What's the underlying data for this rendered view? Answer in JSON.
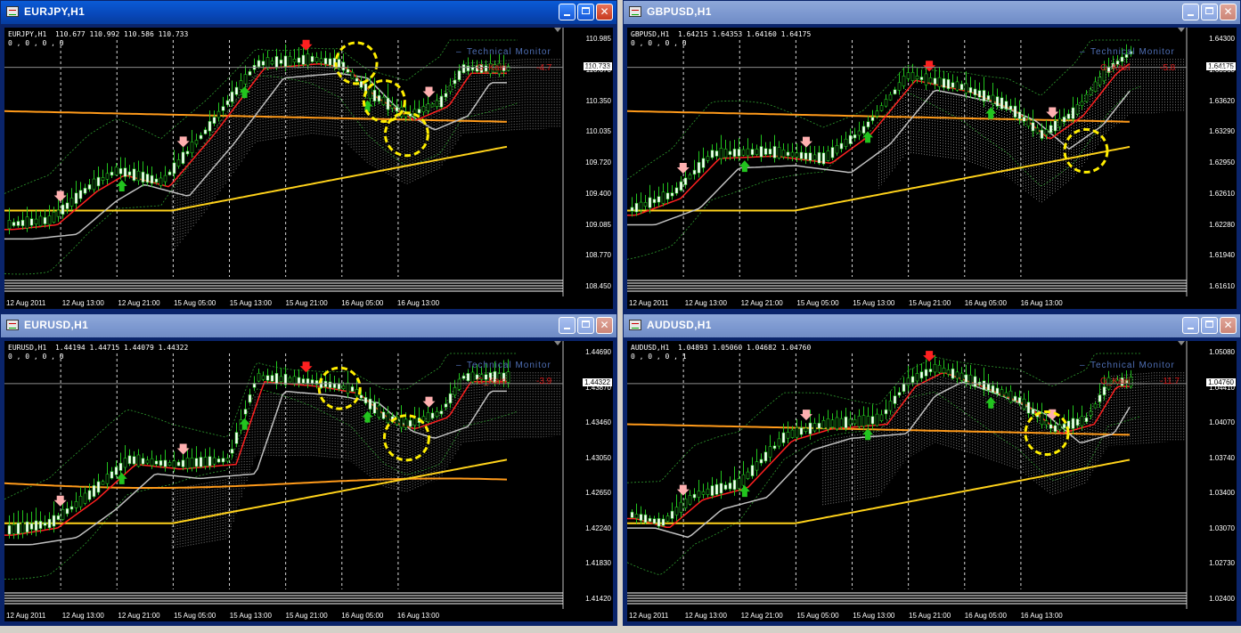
{
  "windows": [
    {
      "key": "eurjpy",
      "title": "EURJPY,H1",
      "header": "EURJPY,H1  110.677 110.992 110.586 110.733\n0 , 0 , 0 , 0",
      "monitor": "Technical  Monitor",
      "kairi_label": "G_Kairi",
      "kairi_value": "-4.7",
      "price_labels": [
        "110.985",
        "110.733",
        "110.670",
        "110.350",
        "110.035",
        "109.720",
        "109.400",
        "109.085",
        "108.770",
        "108.450"
      ],
      "current_price": "110.733",
      "time_labels": [
        "12 Aug 2011",
        "12 Aug 13:00",
        "12 Aug 21:00",
        "15 Aug 05:00",
        "15 Aug 13:00",
        "15 Aug 21:00",
        "16 Aug 05:00",
        "16 Aug 13:00"
      ]
    },
    {
      "key": "gbpusd",
      "title": "GBPUSD,H1",
      "header": "GBPUSD,H1  1.64215 1.64353 1.64160 1.64175\n0 , 0 , 0 , 0",
      "monitor": "Technical  Monitor",
      "kairi_label": "G_Kairi",
      "kairi_value": "-5.8",
      "price_labels": [
        "1.64300",
        "1.64175",
        "1.63960",
        "1.63620",
        "1.63290",
        "1.62950",
        "1.62610",
        "1.62280",
        "1.61940",
        "1.61610"
      ],
      "current_price": "1.64175",
      "time_labels": [
        "12 Aug 2011",
        "12 Aug 13:00",
        "12 Aug 21:00",
        "15 Aug 05:00",
        "15 Aug 13:00",
        "15 Aug 21:00",
        "16 Aug 05:00",
        "16 Aug 13:00"
      ]
    },
    {
      "key": "eurusd",
      "title": "EURUSD,H1",
      "header": "EURUSD,H1  1.44194 1.44715 1.44079 1.44322\n0 , 0 , 0 , 0",
      "monitor": "Technical  Monitor",
      "kairi_label": "G_Kairi",
      "kairi_value": "-3.9",
      "price_labels": [
        "1.44690",
        "1.44322",
        "1.43870",
        "1.43460",
        "1.43050",
        "1.42650",
        "1.42240",
        "1.41830",
        "1.41420"
      ],
      "current_price": "1.44322",
      "time_labels": [
        "12 Aug 2011",
        "12 Aug 13:00",
        "12 Aug 21:00",
        "15 Aug 05:00",
        "15 Aug 13:00",
        "15 Aug 21:00",
        "16 Aug 05:00",
        "16 Aug 13:00"
      ]
    },
    {
      "key": "audusd",
      "title": "AUDUSD,H1",
      "header": "AUDUSD,H1  1.04893 1.05060 1.04682 1.04760\n0 , 0 , 0 , 1",
      "monitor": "Technical  Monitor",
      "kairi_label": "G_Kairi",
      "kairi_value": "-11.7",
      "price_labels": [
        "1.05080",
        "1.04760",
        "1.04410",
        "1.04070",
        "1.03740",
        "1.03400",
        "1.03070",
        "1.02730",
        "1.02400"
      ],
      "current_price": "1.04760",
      "time_labels": [
        "12 Aug 2011",
        "12 Aug 13:00",
        "12 Aug 21:00",
        "15 Aug 05:00",
        "15 Aug 13:00",
        "15 Aug 21:00",
        "16 Aug 05:00",
        "16 Aug 13:00"
      ]
    }
  ],
  "colors": {
    "active_title": "#0847b8",
    "inactive_title": "#7b97cf",
    "bull_candle": "#ffffff",
    "bear_candle": "#000000",
    "wick": "#22c41e",
    "ema_fast": "#ff2020",
    "ema_mid": "#c0c0c0",
    "ema_slow_1": "#ff9a1a",
    "ema_slow_2": "#ffd21a",
    "sell_arrow": "#ff2020",
    "buy_arrow": "#22c41e",
    "highlight_circle": "#ffee00"
  }
}
